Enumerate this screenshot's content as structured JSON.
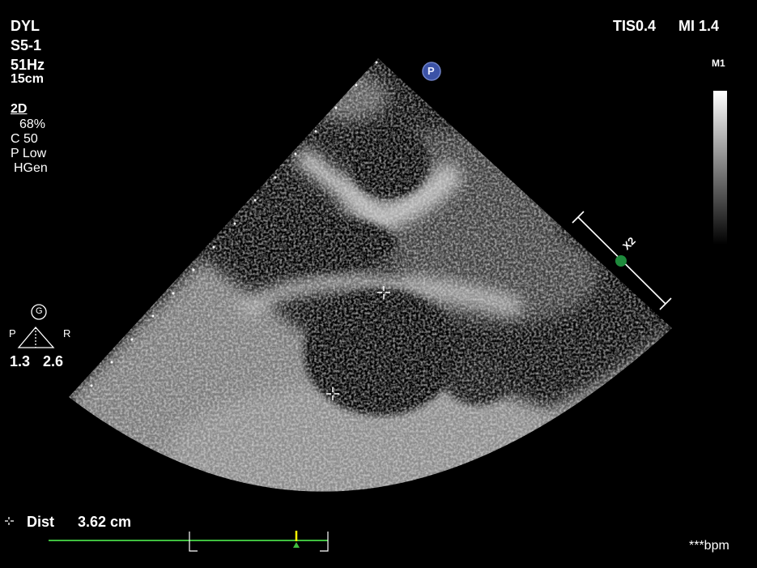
{
  "colors": {
    "background": "#000000",
    "text": "#ffffff",
    "caliper_green": "#3fbf3f",
    "probe_blue": "#3b52a6",
    "marker_green": "#1e8a3c",
    "cursor_yellow": "#ffff00"
  },
  "top_left": {
    "preset": "DYL",
    "probe": "S5-1",
    "frame_rate": "51Hz",
    "depth": "15cm"
  },
  "mode_panel": {
    "mode": "2D",
    "gain": "68%",
    "compression": "C 50",
    "power": "P Low",
    "frequency": "HGen"
  },
  "top_right": {
    "tis": "TIS0.4",
    "mi": "MI 1.4"
  },
  "grayscale_bar_label": "M1",
  "probe_marker_letter": "P",
  "orientation": {
    "gain_icon_letter": "G",
    "left_label": "P",
    "right_label": "R",
    "left_value": "1.3",
    "right_value": "2.6"
  },
  "zoom_scale_label": "X2",
  "measurement": {
    "label": "Dist",
    "value": "3.62 cm"
  },
  "heart_rate": "***bpm",
  "icons": {
    "caliper_marker": "crosshair-icon",
    "probe_marker": "probe-orientation-icon",
    "gain_icon": "gain-icon"
  }
}
